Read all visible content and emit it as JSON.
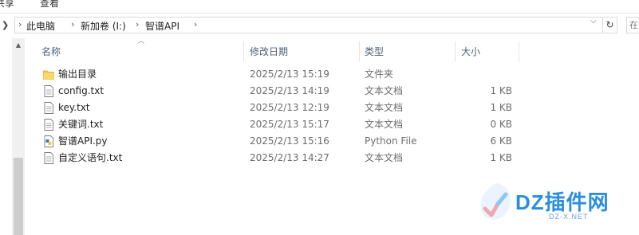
{
  "ribbon": {
    "tabs": [
      "共享",
      "查看"
    ]
  },
  "address": {
    "crumbs": [
      "此电脑",
      "新加卷 (I:)",
      "智谱API"
    ],
    "search_placeholder": "在"
  },
  "columns": {
    "name": "名称",
    "date": "修改日期",
    "type": "类型",
    "size": "大小"
  },
  "files": [
    {
      "name": "输出目录",
      "date": "2025/2/13 15:19",
      "type": "文件夹",
      "size": "",
      "icon": "folder-icon"
    },
    {
      "name": "config.txt",
      "date": "2025/2/13 14:19",
      "type": "文本文档",
      "size": "1 KB",
      "icon": "text-file-icon"
    },
    {
      "name": "key.txt",
      "date": "2025/2/13 12:19",
      "type": "文本文档",
      "size": "1 KB",
      "icon": "text-file-icon"
    },
    {
      "name": "关键词.txt",
      "date": "2025/2/13 15:17",
      "type": "文本文档",
      "size": "0 KB",
      "icon": "text-file-icon"
    },
    {
      "name": "智谱API.py",
      "date": "2025/2/13 15:16",
      "type": "Python File",
      "size": "6 KB",
      "icon": "python-file-icon"
    },
    {
      "name": "自定义语句.txt",
      "date": "2025/2/13 14:27",
      "type": "文本文档",
      "size": "1 KB",
      "icon": "text-file-icon"
    }
  ],
  "watermark": {
    "text": "DZ插件网",
    "sub": "DZ-X.NET"
  },
  "colors": {
    "folder": "#f8c94a",
    "header_text": "#4c607a",
    "watermark": "#2a8ee0"
  }
}
